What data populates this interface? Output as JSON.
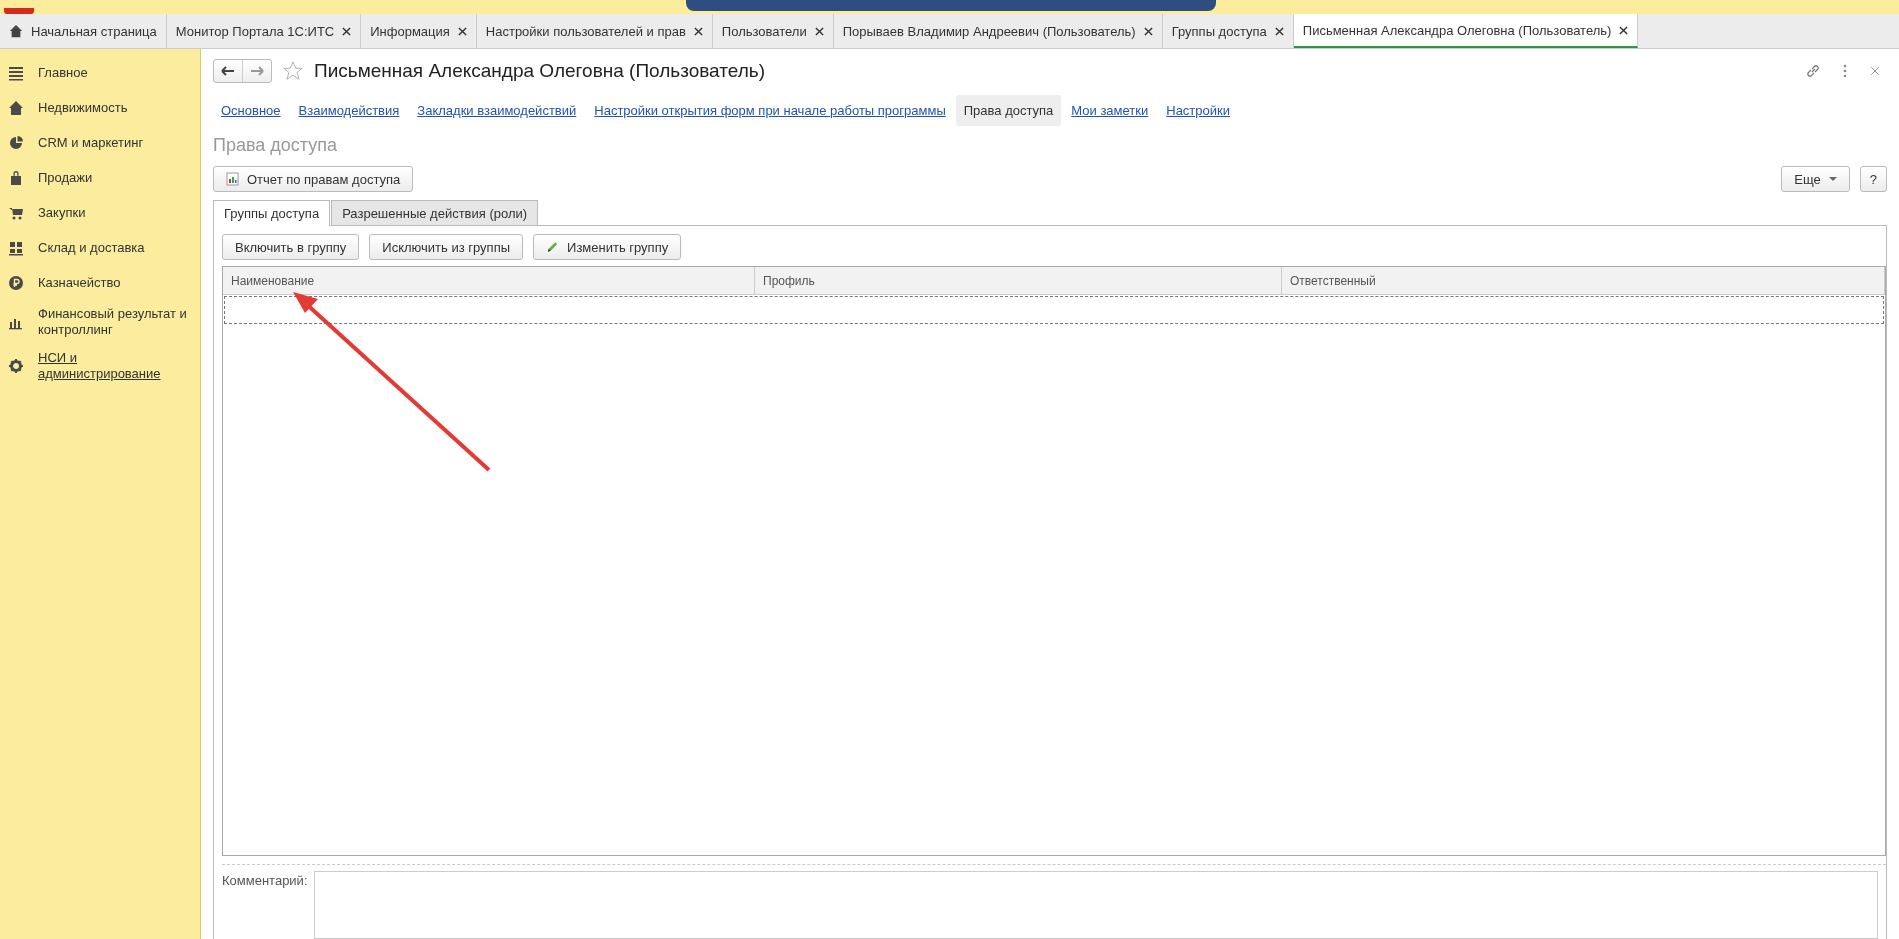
{
  "open_tabs": [
    {
      "label": "Начальная страница",
      "kind": "home",
      "selected": false
    },
    {
      "label": "Монитор Портала 1С:ИТС",
      "kind": "tab",
      "selected": false
    },
    {
      "label": "Информация",
      "kind": "tab",
      "selected": false
    },
    {
      "label": "Настройки пользователей и прав",
      "kind": "tab",
      "selected": false
    },
    {
      "label": "Пользователи",
      "kind": "tab",
      "selected": false
    },
    {
      "label": "Порываев Владимир Андреевич (Пользователь)",
      "kind": "tab",
      "selected": false
    },
    {
      "label": "Группы доступа",
      "kind": "tab",
      "selected": false
    },
    {
      "label": "Письменная Александра Олеговна (Пользователь)",
      "kind": "tab",
      "selected": true
    }
  ],
  "sidebar": {
    "items": [
      {
        "label": "Главное",
        "link": false
      },
      {
        "label": "Недвижимость",
        "link": false
      },
      {
        "label": "CRM и маркетинг",
        "link": false
      },
      {
        "label": "Продажи",
        "link": false
      },
      {
        "label": "Закупки",
        "link": false
      },
      {
        "label": "Склад и доставка",
        "link": false
      },
      {
        "label": "Казначейство",
        "link": false
      },
      {
        "label": "Финансовый результат и контроллинг",
        "link": false
      },
      {
        "label": "НСИ и администрирование",
        "link": true
      }
    ]
  },
  "form": {
    "title": "Письменная Александра Олеговна (Пользователь)",
    "sections": [
      {
        "label": "Основное",
        "selected": false
      },
      {
        "label": "Взаимодействия",
        "selected": false
      },
      {
        "label": "Закладки взаимодействий",
        "selected": false
      },
      {
        "label": "Настройки открытия форм при начале работы программы",
        "selected": false
      },
      {
        "label": "Права доступа",
        "selected": true
      },
      {
        "label": "Мои заметки",
        "selected": false
      },
      {
        "label": "Настройки",
        "selected": false
      }
    ],
    "heading": "Права доступа",
    "report_button": "Отчет по правам доступа",
    "more_button": "Еще",
    "help_button": "?",
    "inner_tabs": [
      {
        "label": "Группы доступа",
        "selected": true
      },
      {
        "label": "Разрешенные действия (роли)",
        "selected": false
      }
    ],
    "actions": [
      {
        "label": "Включить в группу",
        "kind": "plain"
      },
      {
        "label": "Исключить из группы",
        "kind": "plain"
      },
      {
        "label": "Изменить группу",
        "kind": "edit"
      }
    ],
    "table": {
      "columns": [
        "Наименование",
        "Профиль",
        "Ответственный"
      ]
    },
    "comment_label": "Комментарий:"
  }
}
